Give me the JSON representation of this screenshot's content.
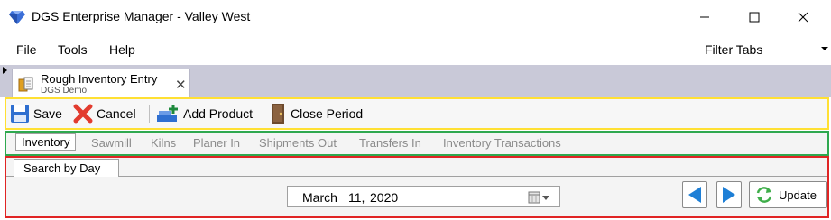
{
  "window": {
    "title": "DGS Enterprise Manager - Valley West",
    "icon": "gem-icon",
    "controls": [
      "minimize-icon",
      "maximize-icon",
      "close-icon"
    ]
  },
  "menu": {
    "items": [
      "File",
      "Tools",
      "Help"
    ],
    "filter_tabs_label": "Filter Tabs"
  },
  "document_tab": {
    "title": "Rough Inventory Entry",
    "subtitle": "DGS Demo",
    "close_glyph": "✕"
  },
  "toolbar": {
    "save_label": "Save",
    "cancel_label": "Cancel",
    "add_product_label": "Add Product",
    "close_period_label": "Close Period"
  },
  "section_tabs": {
    "active": "Inventory",
    "items": [
      "Inventory",
      "Sawmill",
      "Kilns",
      "Planer In",
      "Shipments Out",
      "Transfers In",
      "Inventory Transactions"
    ]
  },
  "content": {
    "inner_tab_label": "Search by Day",
    "date": {
      "month": "March",
      "day": "11,",
      "year": "2020"
    },
    "update_label": "Update"
  },
  "colors": {
    "toolbar_border": "#ffe033",
    "sections_border": "#2fa84f",
    "content_border": "#e02424",
    "nav_arrow": "#1e7fd6",
    "tab_strip": "#c9c9d8"
  }
}
